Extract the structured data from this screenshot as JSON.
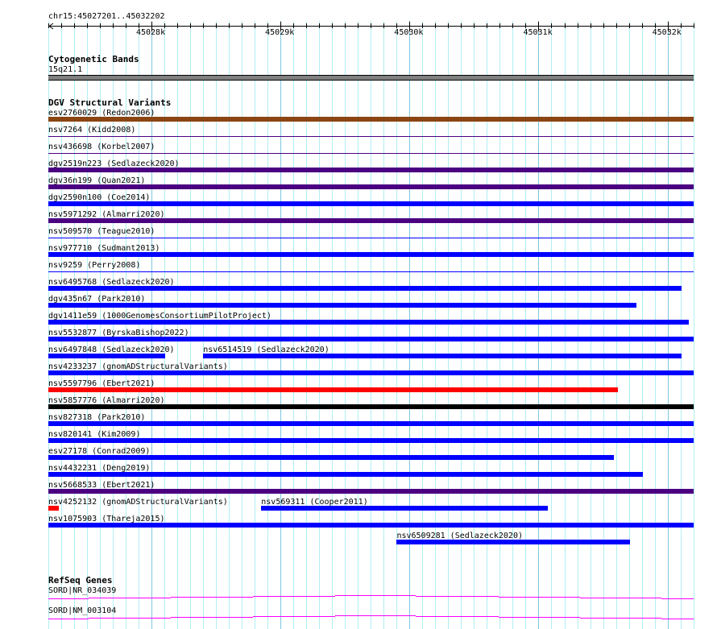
{
  "location": "chr15:45027201..45032202",
  "view": {
    "start": 45027201,
    "end": 45032202
  },
  "ruler_labels": [
    "45028k",
    "45029k",
    "45030k",
    "45031k",
    "45032k"
  ],
  "cytoband_track": {
    "title": "Cytogenetic Bands",
    "band": "15q21.1",
    "color": "#808080"
  },
  "dgv_track": {
    "title": "DGV Structural Variants",
    "colors": {
      "brown": "#8b4513",
      "purple": "#4b0082",
      "blue": "#0000ff",
      "red": "#ff0000",
      "black": "#000000"
    },
    "rows": [
      [
        {
          "label": "esv2760029 (Redon2006)",
          "start": 45027201,
          "end": 45032202,
          "color": "brown",
          "style": "thick"
        }
      ],
      [
        {
          "label": "nsv7264 (Kidd2008)",
          "start": 45027201,
          "end": 45032202,
          "color": "purple",
          "style": "thin"
        }
      ],
      [
        {
          "label": "nsv436698 (Korbel2007)",
          "start": 45027201,
          "end": 45032202,
          "color": "purple",
          "style": "thin"
        }
      ],
      [
        {
          "label": "dgv2519n223 (Sedlazeck2020)",
          "start": 45027201,
          "end": 45032202,
          "color": "purple",
          "style": "thick"
        }
      ],
      [
        {
          "label": "dgv36n199 (Quan2021)",
          "start": 45027201,
          "end": 45032202,
          "color": "purple",
          "style": "thick"
        }
      ],
      [
        {
          "label": "dgv2590n100 (Coe2014)",
          "start": 45027201,
          "end": 45032202,
          "color": "blue",
          "style": "thick"
        }
      ],
      [
        {
          "label": "nsv5971292 (Almarri2020)",
          "start": 45027201,
          "end": 45032202,
          "color": "purple",
          "style": "thick"
        }
      ],
      [
        {
          "label": "nsv509570 (Teague2010)",
          "start": 45027201,
          "end": 45032202,
          "color": "blue",
          "style": "thin"
        }
      ],
      [
        {
          "label": "nsv977710 (Sudmant2013)",
          "start": 45027201,
          "end": 45032202,
          "color": "blue",
          "style": "thick"
        }
      ],
      [
        {
          "label": "nsv9259 (Perry2008)",
          "start": 45027201,
          "end": 45032202,
          "color": "blue",
          "style": "thin"
        }
      ],
      [
        {
          "label": "nsv6495768 (Sedlazeck2020)",
          "start": 45027201,
          "end": 45032107,
          "color": "blue",
          "style": "thick"
        }
      ],
      [
        {
          "label": "dgv435n67 (Park2010)",
          "start": 45027201,
          "end": 45031757,
          "color": "blue",
          "style": "thick"
        }
      ],
      [
        {
          "label": "dgv1411e59 (1000GenomesConsortiumPilotProject)",
          "start": 45027201,
          "end": 45032163,
          "color": "blue",
          "style": "thick"
        }
      ],
      [
        {
          "label": "nsv5532877 (ByrskaBishop2022)",
          "start": 45027201,
          "end": 45032202,
          "color": "blue",
          "style": "thick"
        }
      ],
      [
        {
          "label": "nsv6497848 (Sedlazeck2020)",
          "start": 45027201,
          "end": 45028107,
          "color": "blue",
          "style": "thick"
        },
        {
          "label": "nsv6514519 (Sedlazeck2020)",
          "start": 45028401,
          "end": 45032107,
          "color": "blue",
          "style": "thick"
        }
      ],
      [
        {
          "label": "nsv4233237 (gnomADStructuralVariants)",
          "start": 45027201,
          "end": 45032202,
          "color": "blue",
          "style": "thick"
        }
      ],
      [
        {
          "label": "nsv5597796 (Ebert2021)",
          "start": 45027201,
          "end": 45031613,
          "color": "red",
          "style": "thick"
        }
      ],
      [
        {
          "label": "nsv5857776 (Almarri2020)",
          "start": 45027201,
          "end": 45032202,
          "color": "black",
          "style": "thick"
        }
      ],
      [
        {
          "label": "nsv827318 (Park2010)",
          "start": 45027201,
          "end": 45032202,
          "color": "blue",
          "style": "thick"
        }
      ],
      [
        {
          "label": "nsv820141 (Kim2009)",
          "start": 45027201,
          "end": 45032202,
          "color": "blue",
          "style": "thick"
        }
      ],
      [
        {
          "label": "esv27178 (Conrad2009)",
          "start": 45027201,
          "end": 45031582,
          "color": "blue",
          "style": "thick"
        }
      ],
      [
        {
          "label": "nsv4432231 (Deng2019)",
          "start": 45027201,
          "end": 45031807,
          "color": "blue",
          "style": "thick"
        }
      ],
      [
        {
          "label": "nsv5668533 (Ebert2021)",
          "start": 45027201,
          "end": 45032202,
          "color": "purple",
          "style": "thick"
        }
      ],
      [
        {
          "label": "nsv4252132 (gnomADStructuralVariants)",
          "start": 45027201,
          "end": 45027282,
          "color": "red",
          "style": "thick"
        },
        {
          "label": "nsv569311 (Cooper2011)",
          "start": 45028851,
          "end": 45031070,
          "color": "blue",
          "style": "thick"
        }
      ],
      [
        {
          "label": "nsv1075903 (Thareja2015)",
          "start": 45027201,
          "end": 45032202,
          "color": "blue",
          "style": "thick"
        }
      ],
      [
        {
          "label": "nsv6509281 (Sedlazeck2020)",
          "start": 45029901,
          "end": 45031707,
          "color": "blue",
          "style": "thick"
        }
      ]
    ]
  },
  "refseq_track": {
    "title": "RefSeq Genes",
    "color": "#ff00ff",
    "genes": [
      {
        "label": "SORD|NR_034039"
      },
      {
        "label": "SORD|NM_003104"
      }
    ]
  }
}
